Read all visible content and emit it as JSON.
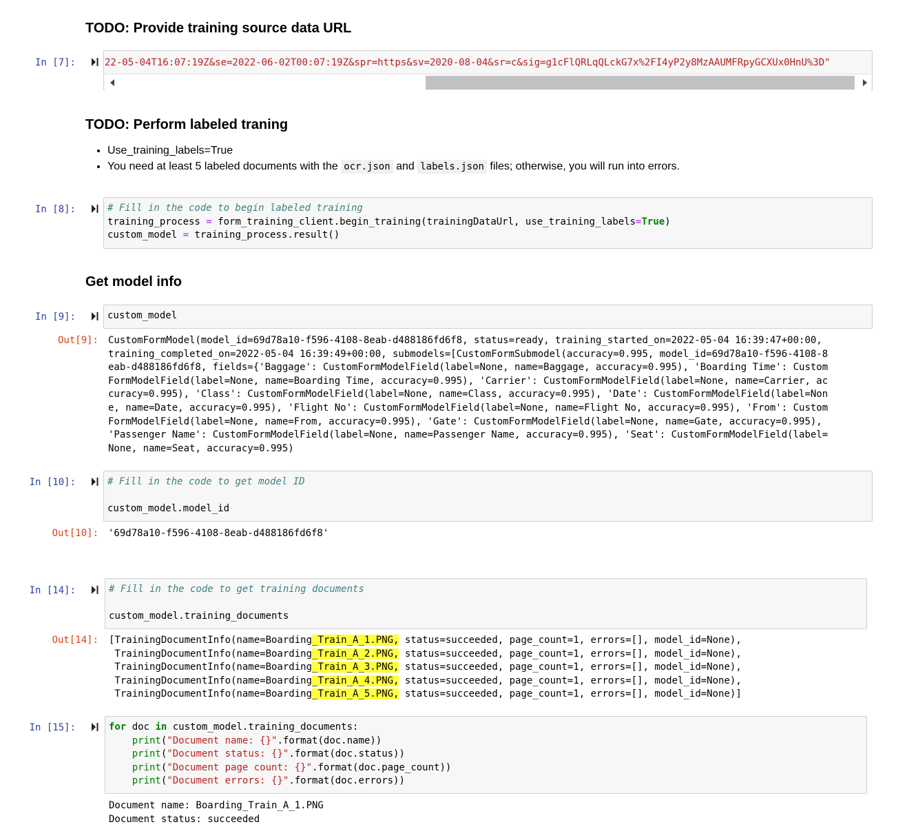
{
  "sections": {
    "h1": "TODO: Provide training source data URL",
    "h2": "TODO: Perform labeled traning",
    "h3": "Get model info"
  },
  "bullets": {
    "b1": "Use_training_labels=True",
    "b2_pre": "You need at least 5 labeled documents with the ",
    "b2_code1": "ocr.json",
    "b2_mid": " and ",
    "b2_code2": "labels.json",
    "b2_post": " files; otherwise, you will run into errors."
  },
  "cells": {
    "c7": {
      "prompt": "In [7]:",
      "code": "22-05-04T16:07:19Z&se=2022-06-02T00:07:19Z&spr=https&sv=2020-08-04&sr=c&sig=g1cFlQRLqQLckG7x%2FI4yP2y8MzAAUMFRpyGCXUx0HnU%3D\""
    },
    "c8": {
      "prompt": "In [8]:",
      "comment": "# Fill in the code to begin labeled training",
      "l2a": "training_process ",
      "l2op": "=",
      "l2b": " form_training_client.begin_training(trainingDataUrl, use_training_labels",
      "l2op2": "=",
      "l2kw": "True",
      "l2c": ")",
      "l3a": "custom_model ",
      "l3op": "=",
      "l3b": " training_process.result()"
    },
    "c9": {
      "prompt": "In [9]:",
      "code": "custom_model",
      "out_prompt": "Out[9]:",
      "output": "CustomFormModel(model_id=69d78a10-f596-4108-8eab-d488186fd6f8, status=ready, training_started_on=2022-05-04 16:39:47+00:00,\ntraining_completed_on=2022-05-04 16:39:49+00:00, submodels=[CustomFormSubmodel(accuracy=0.995, model_id=69d78a10-f596-4108-8\neab-d488186fd6f8, fields={'Baggage': CustomFormModelField(label=None, name=Baggage, accuracy=0.995), 'Boarding Time': Custom\nFormModelField(label=None, name=Boarding Time, accuracy=0.995), 'Carrier': CustomFormModelField(label=None, name=Carrier, ac\ncuracy=0.995), 'Class': CustomFormModelField(label=None, name=Class, accuracy=0.995), 'Date': CustomFormModelField(label=Non\ne, name=Date, accuracy=0.995), 'Flight No': CustomFormModelField(label=None, name=Flight No, accuracy=0.995), 'From': Custom\nFormModelField(label=None, name=From, accuracy=0.995), 'Gate': CustomFormModelField(label=None, name=Gate, accuracy=0.995),\n'Passenger Name': CustomFormModelField(label=None, name=Passenger Name, accuracy=0.995), 'Seat': CustomFormModelField(label=\nNone, name=Seat, accuracy=0.995)"
    },
    "c10": {
      "prompt": "In [10]:",
      "comment": "# Fill in the code to get model ID",
      "code": "custom_model.model_id",
      "out_prompt": "Out[10]:",
      "output": "'69d78a10-f596-4108-8eab-d488186fd6f8'"
    },
    "c14": {
      "prompt": "In [14]:",
      "comment": "# Fill in the code to get training documents",
      "code": "custom_model.training_documents",
      "out_prompt": "Out[14]:",
      "rows": [
        {
          "pre": "[TrainingDocumentInfo(name=Boarding",
          "hl": "_Train_A_1.PNG,",
          "post": " status=succeeded, page_count=1, errors=[], model_id=None),"
        },
        {
          "pre": " TrainingDocumentInfo(name=Boarding",
          "hl": "_Train_A_2.PNG,",
          "post": " status=succeeded, page_count=1, errors=[], model_id=None),"
        },
        {
          "pre": " TrainingDocumentInfo(name=Boarding",
          "hl": "_Train_A_3.PNG,",
          "post": " status=succeeded, page_count=1, errors=[], model_id=None),"
        },
        {
          "pre": " TrainingDocumentInfo(name=Boarding",
          "hl": "_Train_A_4.PNG,",
          "post": " status=succeeded, page_count=1, errors=[], model_id=None),"
        },
        {
          "pre": " TrainingDocumentInfo(name=Boarding",
          "hl": "_Train_A_5.PNG,",
          "post": " status=succeeded, page_count=1, errors=[], model_id=None)]"
        }
      ]
    },
    "c15": {
      "prompt": "In [15]:",
      "l1kw1": "for",
      "l1a": " doc ",
      "l1kw2": "in",
      "l1b": " custom_model.training_documents:",
      "l2f": "print",
      "l2s": "\"Document name: {}\"",
      "l2r": ".format(doc.name))",
      "l3f": "print",
      "l3s": "\"Document status: {}\"",
      "l3r": ".format(doc.status))",
      "l4f": "print",
      "l4s": "\"Document page count: {}\"",
      "l4r": ".format(doc.page_count))",
      "l5f": "print",
      "l5s": "\"Document errors: {}\"",
      "l5r": ".format(doc.errors))",
      "out1": "Document name: Boarding_Train_A_1.PNG",
      "out2": "Document status: succeeded"
    }
  },
  "icons": {
    "run": "run-cell-icon",
    "left": "scroll-left-icon",
    "right": "scroll-right-icon"
  }
}
